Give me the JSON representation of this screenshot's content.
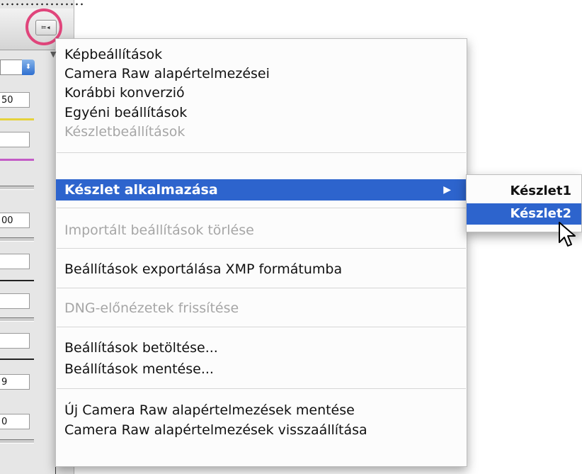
{
  "panel": {
    "menu_button_glyph": "≔◂",
    "values": [
      "50",
      "00",
      "9",
      "0"
    ]
  },
  "menu": {
    "items": [
      {
        "label": "Képbeállítások",
        "checked": true
      },
      {
        "label": "Camera Raw alapértelmezései"
      },
      {
        "label": "Korábbi konverzió"
      },
      {
        "label": "Egyéni beállítások"
      },
      {
        "label": "Készletbeállítások",
        "disabled": true
      },
      {
        "label": "Készlet alkalmazása",
        "selected": true,
        "has_submenu": true
      },
      {
        "label": "Importált beállítások törlése",
        "disabled": true
      },
      {
        "label": "Beállítások exportálása XMP formátumba"
      },
      {
        "label": "DNG-előnézetek frissítése",
        "disabled": true
      },
      {
        "label": "Beállítások betöltése..."
      },
      {
        "label": "Beállítások mentése..."
      },
      {
        "label": "Új Camera Raw alapértelmezések mentése"
      },
      {
        "label": "Camera Raw alapértelmezések visszaállítása"
      }
    ],
    "check_glyph": "▼",
    "submenu_arrow_glyph": "▶"
  },
  "submenu": {
    "items": [
      {
        "label": "Készlet1"
      },
      {
        "label": "Készlet2",
        "selected": true
      }
    ]
  },
  "colors": {
    "selection": "#2d64cd",
    "highlight_ring": "#e0457b"
  }
}
